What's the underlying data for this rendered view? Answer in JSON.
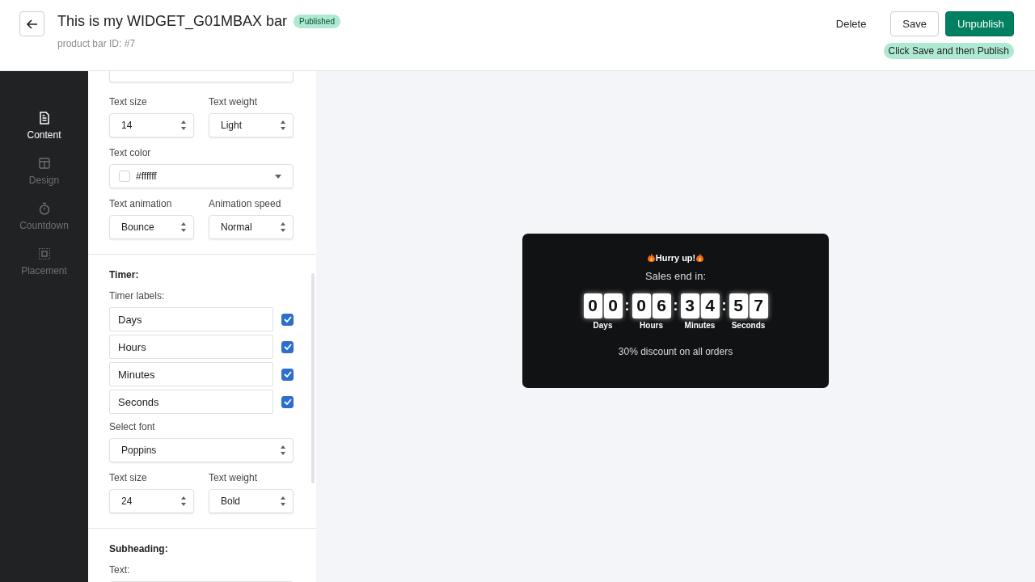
{
  "header": {
    "title": "This is my WIDGET_G01MBAX bar",
    "status": "Published",
    "subtitle": "product bar ID: #7",
    "actions": [
      {
        "label": "Delete",
        "kind": "plain"
      },
      {
        "label": "Save",
        "kind": "outline"
      },
      {
        "label": "Unpublish",
        "kind": "primary"
      }
    ],
    "hint": "Click Save and then Publish"
  },
  "sidebar": {
    "items": [
      {
        "label": "Content",
        "selected": true
      },
      {
        "label": "Design",
        "selected": false
      },
      {
        "label": "Countdown",
        "selected": false
      },
      {
        "label": "Placement",
        "selected": false
      }
    ]
  },
  "settings": {
    "heading_style": [
      {
        "kind": "pair",
        "fields": [
          {
            "label": "Text size",
            "value": "14"
          },
          {
            "label": "Text weight",
            "value": "Light"
          }
        ]
      },
      {
        "kind": "color",
        "label": "Text color",
        "value": "#ffffff"
      },
      {
        "kind": "pair",
        "fields": [
          {
            "label": "Text animation",
            "value": "Bounce"
          },
          {
            "label": "Animation speed",
            "value": "Normal"
          }
        ]
      }
    ],
    "timer": {
      "title": "Timer:",
      "labels_title": "Timer labels:",
      "labels": [
        {
          "value": "Days",
          "checked": true
        },
        {
          "value": "Hours",
          "checked": true
        },
        {
          "value": "Minutes",
          "checked": true
        },
        {
          "value": "Seconds",
          "checked": true
        }
      ],
      "font": {
        "label": "Select font",
        "value": "Poppins"
      },
      "pair": [
        {
          "label": "Text size",
          "value": "24"
        },
        {
          "label": "Text weight",
          "value": "Bold"
        }
      ]
    },
    "subheading": {
      "title": "Subheading:",
      "text_label": "Text:"
    }
  },
  "preview": {
    "heading": "Hurry up!",
    "subheading": "Sales end in:",
    "units": [
      {
        "digits": [
          "0",
          "0"
        ],
        "label": "Days"
      },
      {
        "digits": [
          "0",
          "6"
        ],
        "label": "Hours"
      },
      {
        "digits": [
          "3",
          "4"
        ],
        "label": "Minutes"
      },
      {
        "digits": [
          "5",
          "7"
        ],
        "label": "Seconds"
      }
    ],
    "separators": [
      ":",
      ":",
      ":"
    ],
    "footer": "30% discount on all orders"
  }
}
